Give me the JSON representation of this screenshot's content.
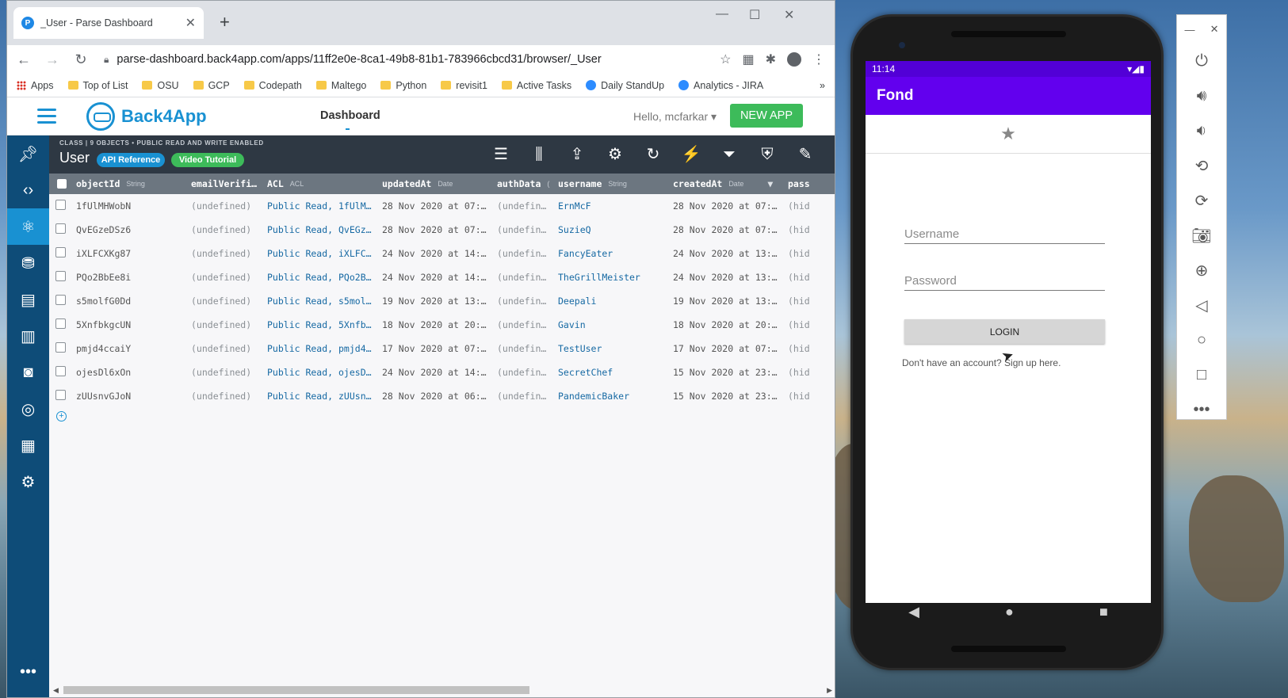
{
  "browser": {
    "tab_title": "_User - Parse Dashboard",
    "tab_close": "✕",
    "new_tab": "+",
    "win_min": "—",
    "win_max": "☐",
    "win_close": "✕",
    "url": "parse-dashboard.back4app.com/apps/11ff2e0e-8ca1-49b8-81b1-783966cbcd31/browser/_User",
    "bookmarks": [
      "Apps",
      "Top of List",
      "OSU",
      "GCP",
      "Codepath",
      "Maltego",
      "Python",
      "revisit1",
      "Active Tasks",
      "Daily StandUp",
      "Analytics - JIRA"
    ],
    "bookmarks_more": "»"
  },
  "app": {
    "brand": "Back4App",
    "nav_dashboard": "Dashboard",
    "greeting": "Hello, mcfarkar",
    "new_app": "NEW APP"
  },
  "class_header": {
    "tag": "CLASS | 9 OBJECTS • PUBLIC READ AND WRITE ENABLED",
    "name": "User",
    "api_reference": "API Reference",
    "video_tutorial": "Video Tutorial"
  },
  "grid": {
    "columns": [
      {
        "name": "objectId",
        "type": "String"
      },
      {
        "name": "emailVerifi…",
        "type": ""
      },
      {
        "name": "ACL",
        "type": "ACL"
      },
      {
        "name": "updatedAt",
        "type": "Date"
      },
      {
        "name": "authData",
        "type": "("
      },
      {
        "name": "username",
        "type": "String"
      },
      {
        "name": "createdAt",
        "type": "Date"
      },
      {
        "name": "pass",
        "type": ""
      }
    ],
    "rows": [
      {
        "objectId": "1fUlMHWobN",
        "email": "(undefined)",
        "acl": "Public Read, 1fUlM…",
        "updated": "28 Nov 2020 at 07:…",
        "auth": "(undefin…",
        "username": "ErnMcF",
        "created": "28 Nov 2020 at 07:…",
        "pass": "(hid"
      },
      {
        "objectId": "QvEGzeDSz6",
        "email": "(undefined)",
        "acl": "Public Read, QvEGz…",
        "updated": "28 Nov 2020 at 07:…",
        "auth": "(undefin…",
        "username": "SuzieQ",
        "created": "28 Nov 2020 at 07:…",
        "pass": "(hid"
      },
      {
        "objectId": "iXLFCXKg87",
        "email": "(undefined)",
        "acl": "Public Read, iXLFC…",
        "updated": "24 Nov 2020 at 14:…",
        "auth": "(undefin…",
        "username": "FancyEater",
        "created": "24 Nov 2020 at 13:…",
        "pass": "(hid"
      },
      {
        "objectId": "PQo2BbEe8i",
        "email": "(undefined)",
        "acl": "Public Read, PQo2B…",
        "updated": "24 Nov 2020 at 14:…",
        "auth": "(undefin…",
        "username": "TheGrillMeister",
        "created": "24 Nov 2020 at 13:…",
        "pass": "(hid"
      },
      {
        "objectId": "s5molfG0Dd",
        "email": "(undefined)",
        "acl": "Public Read, s5mol…",
        "updated": "19 Nov 2020 at 13:…",
        "auth": "(undefin…",
        "username": "Deepali",
        "created": "19 Nov 2020 at 13:…",
        "pass": "(hid"
      },
      {
        "objectId": "5XnfbkgcUN",
        "email": "(undefined)",
        "acl": "Public Read, 5Xnfb…",
        "updated": "18 Nov 2020 at 20:…",
        "auth": "(undefin…",
        "username": "Gavin",
        "created": "18 Nov 2020 at 20:…",
        "pass": "(hid"
      },
      {
        "objectId": "pmjd4ccaiY",
        "email": "(undefined)",
        "acl": "Public Read, pmjd4…",
        "updated": "17 Nov 2020 at 07:…",
        "auth": "(undefin…",
        "username": "TestUser",
        "created": "17 Nov 2020 at 07:…",
        "pass": "(hid"
      },
      {
        "objectId": "ojesDl6xOn",
        "email": "(undefined)",
        "acl": "Public Read, ojesD…",
        "updated": "24 Nov 2020 at 14:…",
        "auth": "(undefin…",
        "username": "SecretChef",
        "created": "15 Nov 2020 at 23:…",
        "pass": "(hid"
      },
      {
        "objectId": "zUUsnvGJoN",
        "email": "(undefined)",
        "acl": "Public Read, zUUsn…",
        "updated": "28 Nov 2020 at 06:…",
        "auth": "(undefin…",
        "username": "PandemicBaker",
        "created": "15 Nov 2020 at 23:…",
        "pass": "(hid"
      }
    ]
  },
  "phone": {
    "time": "11:14",
    "status_icons": "▾◢▮",
    "app_title": "Fond",
    "username_placeholder": "Username",
    "password_placeholder": "Password",
    "login_label": "LOGIN",
    "signup_text": "Don't have an account? Sign up here."
  },
  "emulator": {
    "minimize": "—",
    "close": "✕"
  }
}
